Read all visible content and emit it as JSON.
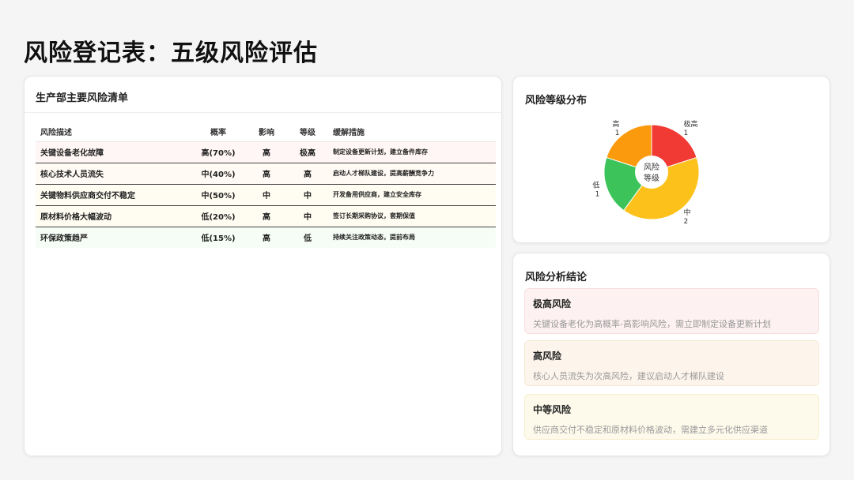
{
  "page": {
    "title": "风险登记表：五级风险评估"
  },
  "risk_list": {
    "title": "生产部主要风险清单",
    "columns": [
      "风险描述",
      "概率",
      "影响",
      "等级",
      "缓解措施"
    ],
    "rows": [
      {
        "desc": "关键设备老化故障",
        "prob": "高(70%)",
        "impact": "高",
        "level": "极高",
        "mitigation": "制定设备更新计划，建立备件库存",
        "bg": "#fff6f5"
      },
      {
        "desc": "核心技术人员流失",
        "prob": "中(40%)",
        "impact": "高",
        "level": "高",
        "mitigation": "启动人才梯队建设，提高薪酬竞争力",
        "bg": "#fffaf3"
      },
      {
        "desc": "关键物料供应商交付不稳定",
        "prob": "中(50%)",
        "impact": "中",
        "level": "中",
        "mitigation": "开发备用供应商，建立安全库存",
        "bg": "#fffdf2"
      },
      {
        "desc": "原材料价格大幅波动",
        "prob": "低(20%)",
        "impact": "高",
        "level": "中",
        "mitigation": "签订长期采购协议，套期保值",
        "bg": "#fffdf2"
      },
      {
        "desc": "环保政策趋严",
        "prob": "低(15%)",
        "impact": "高",
        "level": "低",
        "mitigation": "持续关注政策动态，提前布局",
        "bg": "#f6fdf6"
      }
    ]
  },
  "chart_data": {
    "type": "pie",
    "title": "风险等级分布",
    "center_label": [
      "风险",
      "等级"
    ],
    "categories": [
      "极高",
      "中",
      "低",
      "高"
    ],
    "values": [
      1,
      2,
      1,
      1
    ],
    "value_labels": [
      "1",
      "2",
      "1",
      "1"
    ],
    "colors": [
      "#f03a33",
      "#fcc21b",
      "#3cc35a",
      "#fb9a0d"
    ]
  },
  "conclusions": {
    "title": "风险分析结论",
    "items": [
      {
        "level": "极高风险",
        "text": "关键设备老化为高概率-高影响风险，需立即制定设备更新计划",
        "bg": "#fdf1f1",
        "border": "#f8dede"
      },
      {
        "level": "高风险",
        "text": "核心人员流失为次高风险，建议启动人才梯队建设",
        "bg": "#fdf5ec",
        "border": "#f8e7d4"
      },
      {
        "level": "中等风险",
        "text": "供应商交付不稳定和原材料价格波动，需建立多元化供应渠道",
        "bg": "#fdfaeb",
        "border": "#f6eece"
      }
    ]
  }
}
